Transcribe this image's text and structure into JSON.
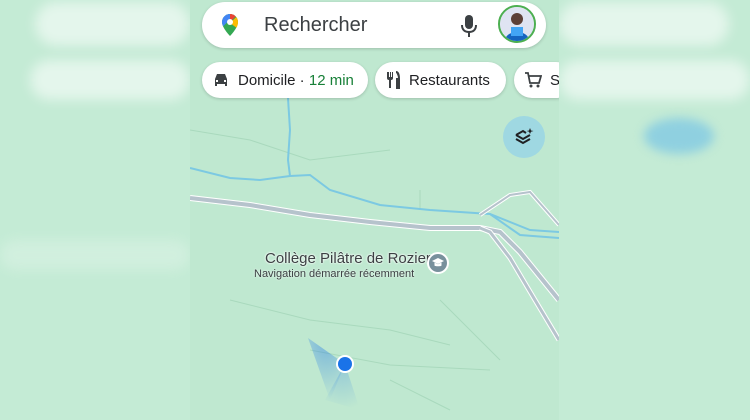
{
  "search": {
    "placeholder_text": "Rechercher",
    "mic_icon": "mic-icon",
    "avatar": "account-avatar"
  },
  "chips": [
    {
      "icon": "car-icon",
      "label": "Domicile",
      "separator": " · ",
      "time": "12 min"
    },
    {
      "icon": "fork-knife-icon",
      "label": "Restaurants"
    },
    {
      "icon": "cart-icon",
      "label": "Su"
    }
  ],
  "map": {
    "poi_name": "Collège Pilâtre de Rozier",
    "poi_subtitle": "Navigation démarrée récemment",
    "poi_icon": "graduation-cap-icon",
    "layers_button": "layers-icon",
    "location_marker": "current-location-dot"
  },
  "colors": {
    "map_bg": "#bfe8d0",
    "water": "#69c7e8",
    "road": "#b6c3cc",
    "accent": "#1a73e8",
    "time_green": "#188038"
  }
}
